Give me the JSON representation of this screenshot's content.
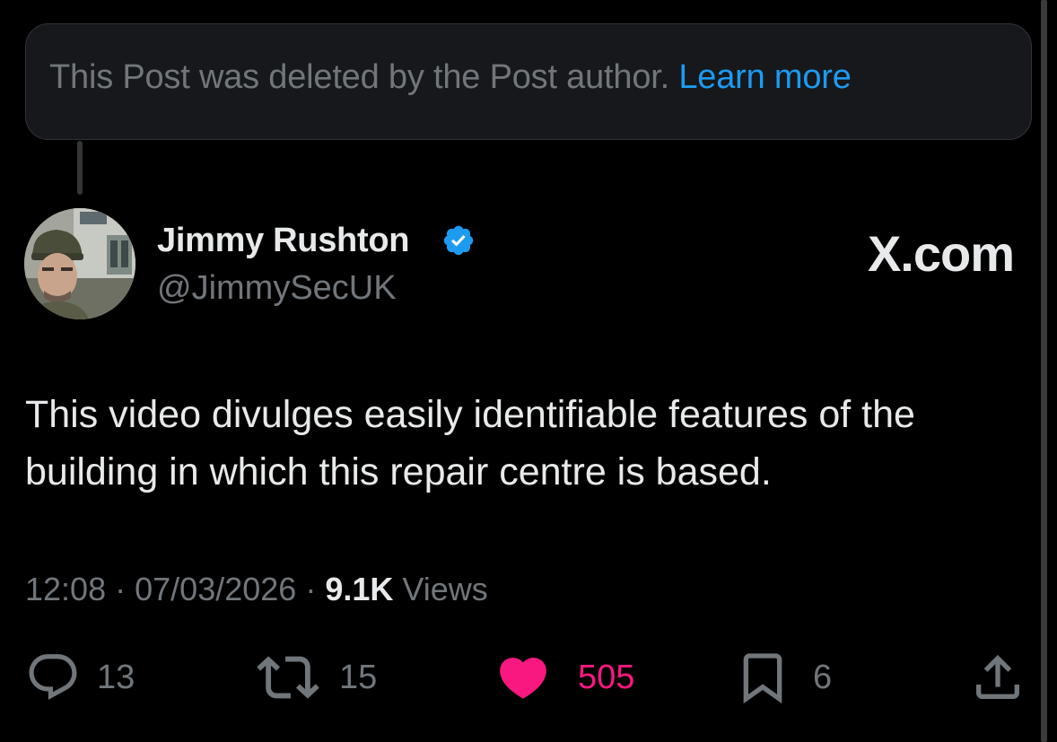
{
  "deleted_notice": {
    "text": "This Post was deleted by the Post author.",
    "link_label": "Learn more"
  },
  "author": {
    "name": "Jimmy Rushton",
    "handle": "@JimmySecUK",
    "verified": true,
    "verified_color": "#1d9bf0"
  },
  "brand": "X.com",
  "post": {
    "text": "This video divulges easily identifiable features of the building in which this repair centre is based."
  },
  "meta": {
    "time": "12:08",
    "separator": "·",
    "date": "07/03/2026",
    "views_count": "9.1K",
    "views_label": "Views"
  },
  "actions": {
    "replies": "13",
    "reposts": "15",
    "likes": "505",
    "bookmarks": "6",
    "liked": true,
    "like_color": "#f91880",
    "icons": [
      "reply-icon",
      "repost-icon",
      "heart-icon",
      "bookmark-icon",
      "share-icon"
    ]
  }
}
